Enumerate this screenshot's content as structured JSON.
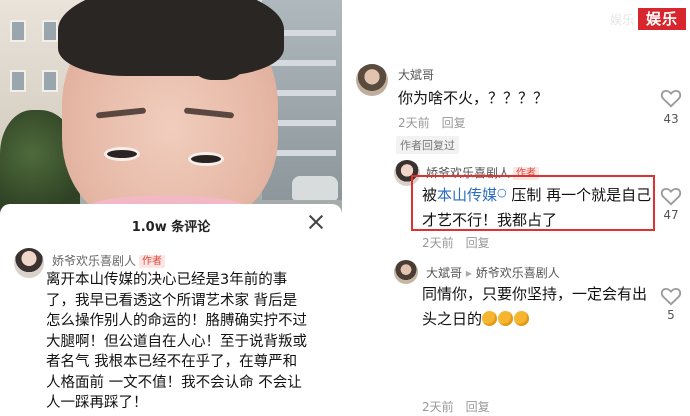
{
  "left": {
    "comments_count": "1.0w 条评论",
    "comment": {
      "user": "娇爷欢乐喜剧人",
      "badge": "作者",
      "text": "离开本山传媒的决心已经是3年前的事了，我早已看透这个所谓艺术家 背后是怎么操作别人的命运的！胳膊确实拧不过大腿啊！但公道自在人心！至于说背叛或者名气 我根本已经不在乎了，在尊严和人格面前 一文不值！我不会认命 不会让人一踩再踩了！"
    }
  },
  "right": {
    "brand": "娱乐",
    "watermark": "娱乐",
    "comments": [
      {
        "user": "大斌哥",
        "text": "你为啥不火，？？？？",
        "time": "2天前",
        "reply": "回复",
        "likes": "43",
        "author_note": "作者回复过"
      },
      {
        "user": "娇爷欢乐喜剧人",
        "badge": "作者",
        "link_text": "本山传媒",
        "text_before": "被",
        "text_after": " 压制 再一个就是自己才艺不行！我都占了",
        "time": "2天前",
        "reply": "回复",
        "likes": "47"
      },
      {
        "user": "大斌哥",
        "reply_to": "娇爷欢乐喜剧人",
        "text": "同情你，只要你坚持，一定会有出头之日的",
        "time": "2天前",
        "reply": "回复",
        "likes": "5"
      }
    ]
  },
  "colors": {
    "highlight_border": "#e0312f",
    "brand_bg": "#d8262e",
    "link": "#2b6cc4",
    "author_tag": "#e0463a"
  },
  "icons": [
    "close-icon",
    "heart-icon",
    "reply-arrow-icon",
    "search-icon"
  ]
}
